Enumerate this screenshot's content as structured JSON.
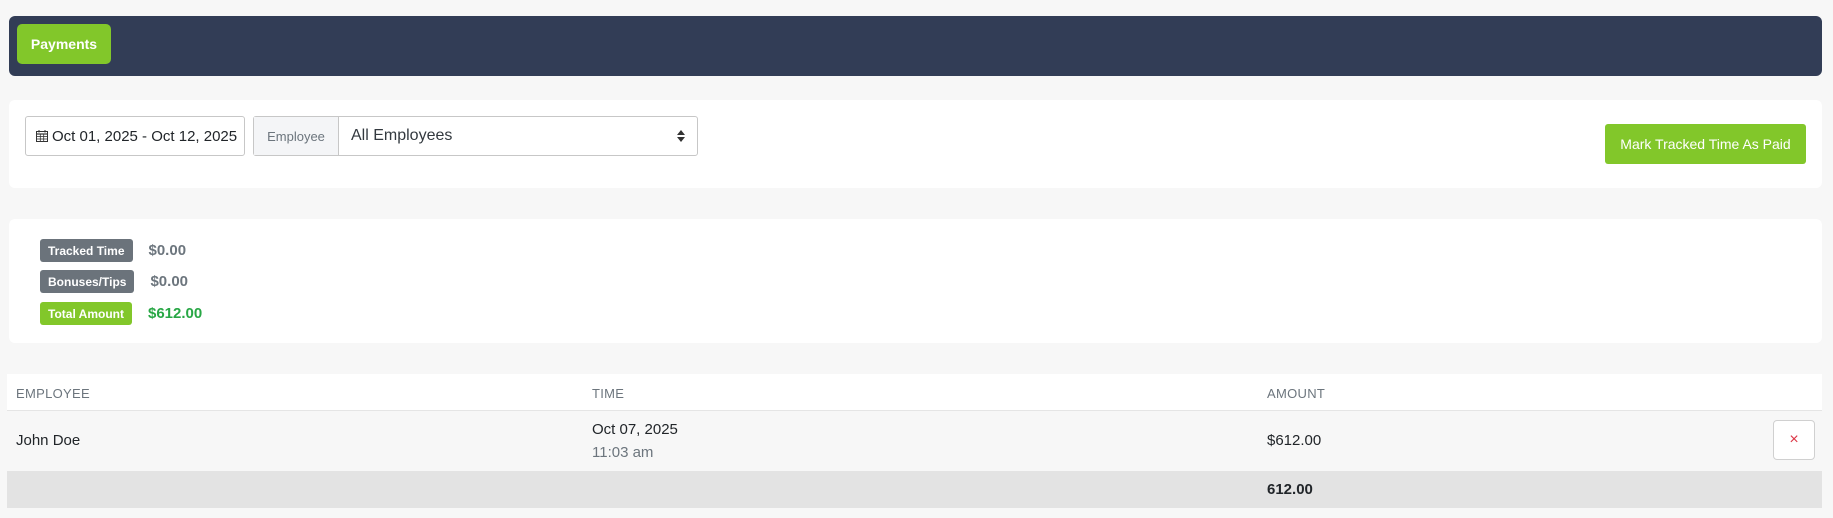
{
  "header": {
    "tab_label": "Payments"
  },
  "filters": {
    "date_range": "Oct 01, 2025 - Oct 12, 2025",
    "employee_label": "Employee",
    "employee_value": "All Employees",
    "mark_paid_label": "Mark Tracked Time As Paid"
  },
  "summary": {
    "tracked_time_label": "Tracked Time",
    "tracked_time_value": "$0.00",
    "bonuses_label": "Bonuses/Tips",
    "bonuses_value": "$0.00",
    "total_label": "Total Amount",
    "total_value": "$612.00"
  },
  "table": {
    "headers": [
      "EMPLOYEE",
      "TIME",
      "AMOUNT"
    ],
    "rows": [
      {
        "employee": "John Doe",
        "date": "Oct 07, 2025",
        "time": "11:03 am",
        "amount": "$612.00",
        "delete_icon": "×"
      }
    ],
    "total": "612.00"
  },
  "colors": {
    "accent_green": "#82c72a",
    "header_navy": "#323d56",
    "total_green": "#28a745",
    "delete_red": "#dc3545"
  }
}
